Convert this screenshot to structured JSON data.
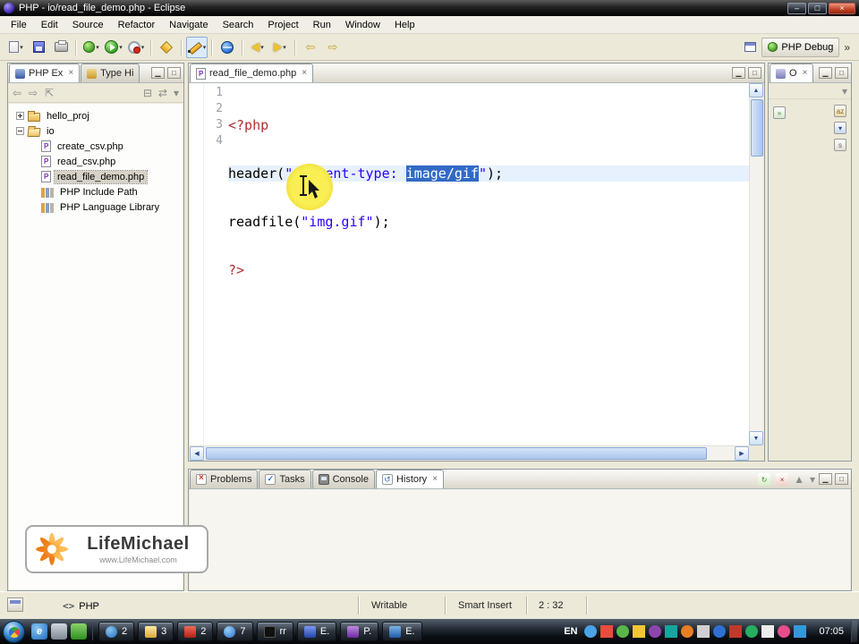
{
  "window": {
    "title": "PHP - io/read_file_demo.php - Eclipse"
  },
  "menu": {
    "items": [
      "File",
      "Edit",
      "Source",
      "Refactor",
      "Navigate",
      "Search",
      "Project",
      "Run",
      "Window",
      "Help"
    ]
  },
  "toolbar": {
    "perspective": "PHP Debug",
    "overflow": "»"
  },
  "explorer": {
    "tab_php": "PHP Ex",
    "tab_type": "Type Hi",
    "project1": "hello_proj",
    "project2": "io",
    "file1": "create_csv.php",
    "file2": "read_csv.php",
    "file3": "read_file_demo.php",
    "lib1": "PHP Include Path",
    "lib2": "PHP Language Library"
  },
  "editor": {
    "tab": "read_file_demo.php",
    "nums": [
      "1",
      "2",
      "3",
      "4"
    ],
    "code": {
      "l1": "<?php",
      "l2a": "header(",
      "l2b": "\"content-type: ",
      "l2sel": "image/gif",
      "l2c": "\"",
      "l2d": ");",
      "l3a": "readfile(",
      "l3b": "\"img.gif\"",
      "l3c": ");",
      "l4": "?>"
    }
  },
  "outline": {
    "tab": "O"
  },
  "bottom": {
    "problems": "Problems",
    "tasks": "Tasks",
    "console": "Console",
    "history": "History"
  },
  "watermark": {
    "brand": "LifeMichael",
    "url": "www.LifeMichael.com"
  },
  "status": {
    "lang_icon": "<>",
    "lang": "PHP",
    "writable": "Writable",
    "insert": "Smart Insert",
    "caret": "2 : 32"
  },
  "taskbar": {
    "g1": "2",
    "g2": "3",
    "g3": "2",
    "g4": "7",
    "a1": "rr",
    "a2": "E.",
    "a3": "P.",
    "a4": "E.",
    "lang": "EN",
    "clock": "07:05"
  },
  "colors": {
    "selection": "#316ac5",
    "string_blue": "#2a00ff",
    "php_tag_red": "#b03030",
    "current_line": "#e7f1fd",
    "brand_orange": "#ee7d16"
  }
}
